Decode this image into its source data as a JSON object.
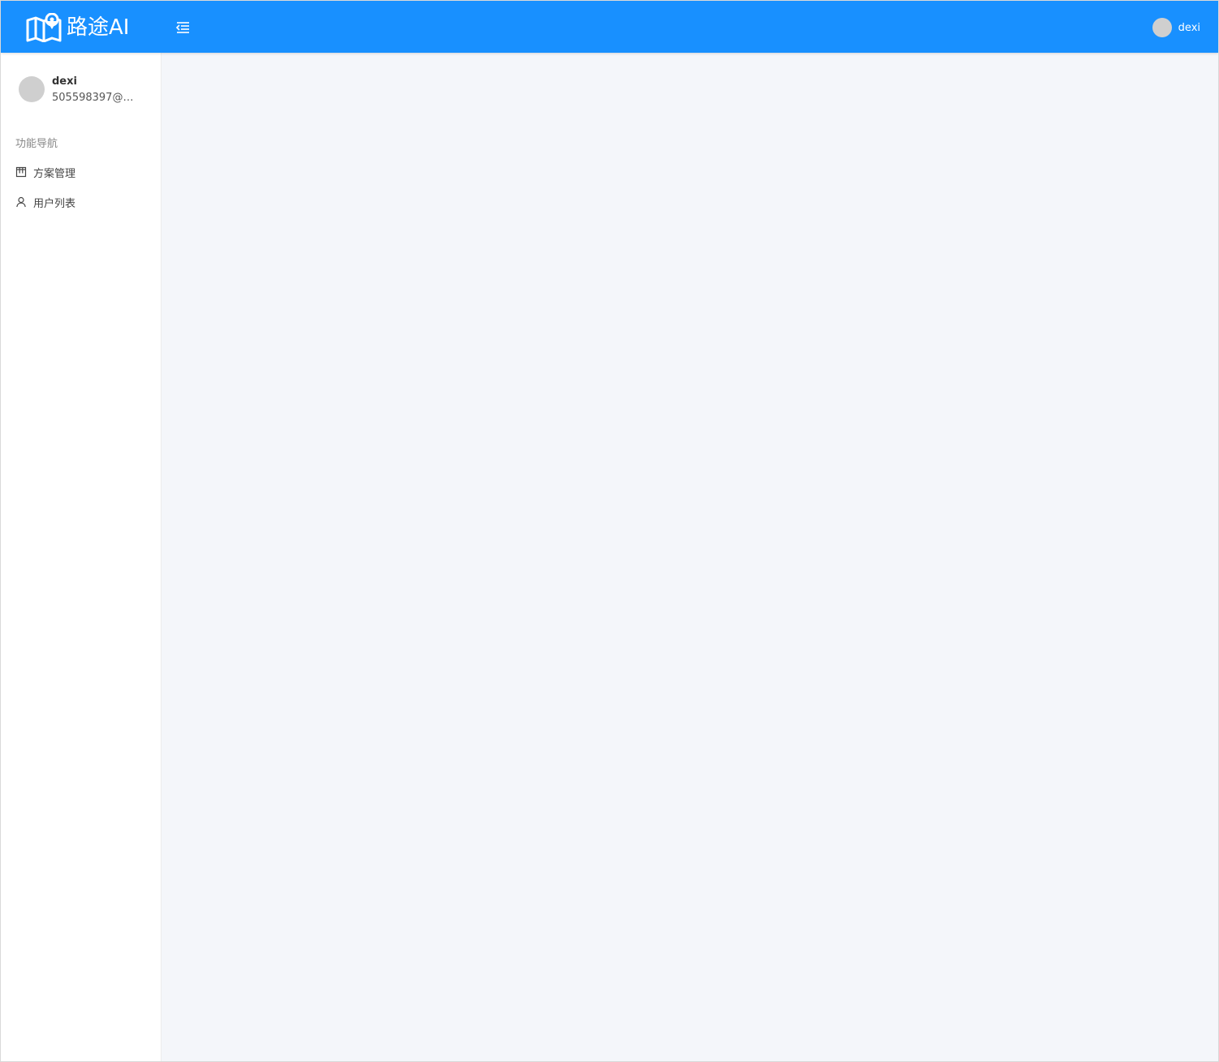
{
  "header": {
    "brand_name": "路途AI",
    "background_color": "#1890ff",
    "username": "dexi"
  },
  "sidebar": {
    "profile": {
      "name": "dexi",
      "email": "505598397@q..."
    },
    "nav_heading": "功能导航",
    "items": [
      {
        "label": "方案管理",
        "icon": "board-icon"
      },
      {
        "label": "用户列表",
        "icon": "user-icon"
      }
    ]
  },
  "main": {
    "background_color": "#f4f6fa"
  }
}
